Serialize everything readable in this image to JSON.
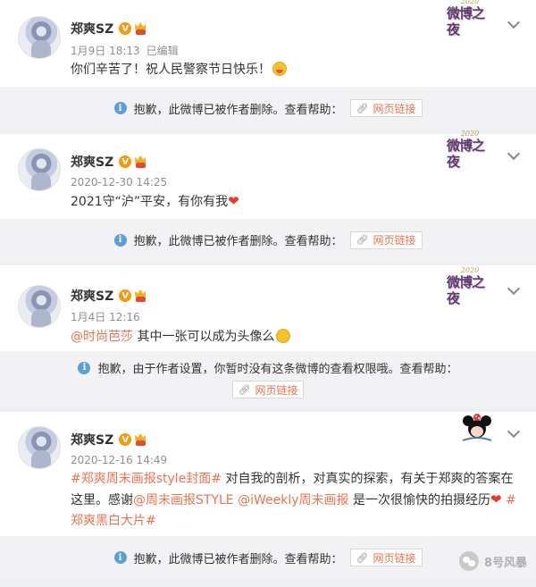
{
  "posts": [
    {
      "author": "郑爽SZ",
      "verified_badge": "V",
      "date": "1月9日 18:13",
      "edited": "已编辑",
      "text": "你们辛苦了！祝人民警察节日快乐！",
      "decoration": {
        "year": "2020",
        "title": "微博之夜"
      },
      "emoji": "smile-emoji",
      "notice": "抱歉，此微博已被作者删除。查看帮助：",
      "link_label": "网页链接"
    },
    {
      "author": "郑爽SZ",
      "verified_badge": "V",
      "date": "2020-12-30 14:25",
      "text": "2021守“沪”平安，有你有我",
      "decoration": {
        "year": "2020",
        "title": "微博之夜"
      },
      "emoji": "heart-emoji",
      "notice": "抱歉，此微博已被作者删除。查看帮助：",
      "link_label": "网页链接"
    },
    {
      "author": "郑爽SZ",
      "verified_badge": "V",
      "date": "1月4日 12:16",
      "mention": "@时尚芭莎",
      "text": " 其中一张可以成为头像么",
      "decoration": {
        "year": "2020",
        "title": "微博之夜"
      },
      "emoji": "pray-emoji",
      "notice": "抱歉，由于作者设置，你暂时没有这条微博的查看权限哦。查看帮助：",
      "link_label": "网页链接"
    },
    {
      "author": "郑爽SZ",
      "verified_badge": "V",
      "date": "2020-12-16 14:49",
      "hashtag1": "#郑爽周末画报style封面#",
      "text1": "  对自我的剖析，对真实的探索，有关于郑爽的答案在这里。感谢",
      "mention1": "@周末画报STYLE",
      "mention2": "@iWeekly周末画报",
      "text2": " 是一次很愉快的拍摄经历",
      "hashtag2": "#郑爽黑白大片#",
      "decoration": "mickey-icon",
      "emoji": "heart-emoji",
      "notice": "抱歉，此微博已被作者删除。查看帮助：",
      "link_label": "网页链接"
    }
  ],
  "watermark": {
    "text": "8号风暴",
    "icon": "wechat-icon"
  },
  "colors": {
    "link": "#eb7350",
    "notice_bg": "#f2f2f5",
    "info": "#5b9fd9"
  }
}
